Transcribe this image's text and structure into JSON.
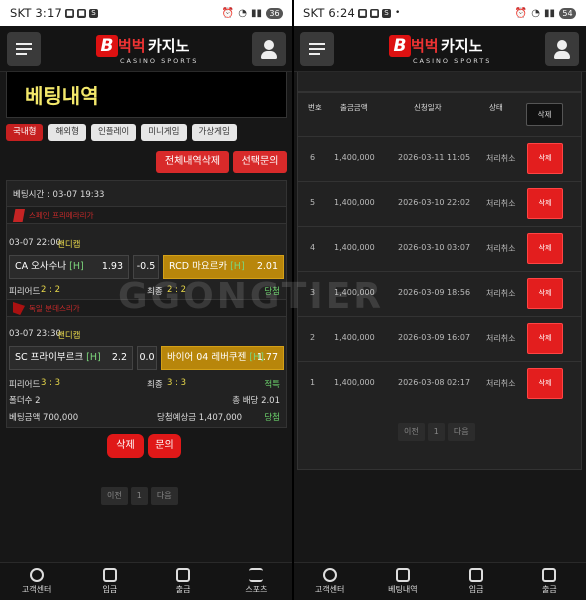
{
  "left": {
    "status": {
      "carrier": "SKT",
      "time": "3:17",
      "battery": "36"
    },
    "title": "베팅내역",
    "tabs": [
      "국내형",
      "해외형",
      "인플레이",
      "미니게임",
      "가상게임"
    ],
    "delete_all_label": "전체내역삭제",
    "inquiry_selected_label": "선택문의",
    "bet_time": "베팅시간 : 03-07 19:33",
    "games": [
      {
        "league": "스페인 프리메라리가",
        "time": "03-07 22:00",
        "type": "핸디캡",
        "home": "CA 오사수나",
        "home_h": "[H]",
        "home_odd": "1.93",
        "handicap": "-0.5",
        "away": "RCD 마요르카",
        "away_h": "[H]",
        "away_odd": "2.01",
        "half_label": "피리어드",
        "half_score": "2 : 2",
        "final_label": "최종",
        "final_score": "2 : 2",
        "result": "당첨"
      },
      {
        "league": "독일 분데스리가",
        "time": "03-07 23:30",
        "type": "핸디캡",
        "home": "SC 프라이부르크",
        "home_h": "[H]",
        "home_odd": "2.2",
        "handicap": "0.0",
        "away": "바이어 04 레버쿠젠",
        "away_h": "[H]",
        "away_odd": "1.77",
        "half_label": "피리어드",
        "half_score": "3 : 3",
        "final_label": "최종",
        "final_score": "3 : 3",
        "result": "적특"
      }
    ],
    "folder_count": "폴더수 2",
    "total_odds": "총 배당 2.01",
    "bet_amount": "베팅금액 700,000",
    "win_amount": "당첨예상금 1,407,000",
    "final_result": "당첨",
    "delete_label": "삭제",
    "inquiry_label": "문의",
    "pager": {
      "prev": "이전",
      "page": "1",
      "next": "다음"
    },
    "nav": [
      "고객센터",
      "입금",
      "출금",
      "스포츠"
    ]
  },
  "right": {
    "status": {
      "carrier": "SKT",
      "time": "6:24",
      "battery": "54"
    },
    "headers": {
      "no": "번호",
      "amount": "출금금액",
      "date": "신청일자",
      "status": "상태",
      "delete": "삭제"
    },
    "rows": [
      {
        "no": "6",
        "amount": "1,400,000",
        "date": "2026-03-11 11:05",
        "status": "처리취소",
        "action": "삭제"
      },
      {
        "no": "5",
        "amount": "1,400,000",
        "date": "2026-03-10 22:02",
        "status": "처리취소",
        "action": "삭제"
      },
      {
        "no": "4",
        "amount": "1,400,000",
        "date": "2026-03-10 03:07",
        "status": "처리취소",
        "action": "삭제"
      },
      {
        "no": "3",
        "amount": "1,400,000",
        "date": "2026-03-09 18:56",
        "status": "처리취소",
        "action": "삭제"
      },
      {
        "no": "2",
        "amount": "1,400,000",
        "date": "2026-03-09 16:07",
        "status": "처리취소",
        "action": "삭제"
      },
      {
        "no": "1",
        "amount": "1,400,000",
        "date": "2026-03-08 02:17",
        "status": "처리취소",
        "action": "삭제"
      }
    ],
    "pager": {
      "prev": "이전",
      "page": "1",
      "next": "다음"
    },
    "nav": [
      "고객센터",
      "베팅내역",
      "입금",
      "출금"
    ]
  },
  "logo": {
    "mark": "B",
    "brand_red": "벅벅",
    "brand_white": "카지노",
    "sub": "CASINO SPORTS"
  },
  "watermark": "GGONGTIER",
  "colors": {
    "accent_red": "#d82a2a",
    "title_yellow": "#f3e86b",
    "selected_gold": "#b8860b",
    "win_green": "#6bd06b"
  }
}
